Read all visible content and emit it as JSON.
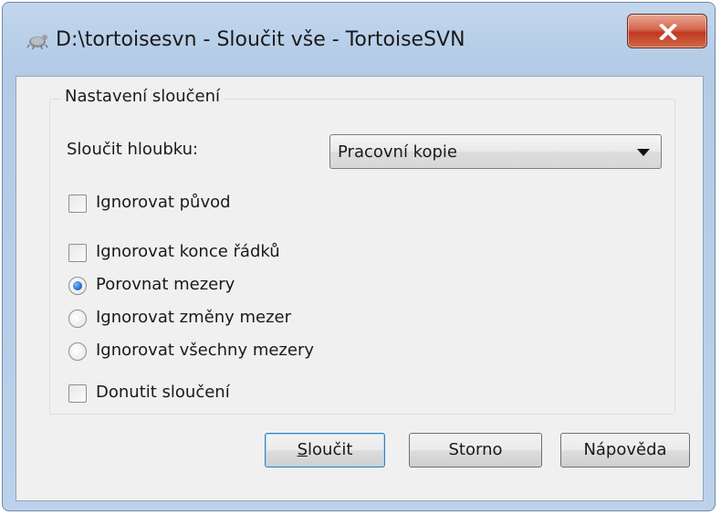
{
  "window": {
    "title": "D:\\tortoisesvn - Sloučit vše - TortoiseSVN",
    "close_glyph": "X"
  },
  "group": {
    "title": "Nastavení sloučení",
    "depth_label": "Sloučit hloubku:",
    "depth_value": "Pracovní kopie"
  },
  "options": {
    "ignore_ancestry": {
      "label": "Ignorovat původ",
      "checked": false
    },
    "ignore_eol": {
      "label": "Ignorovat konce řádků",
      "checked": false
    },
    "compare_whitespace": {
      "label": "Porovnat mezery",
      "selected": true
    },
    "ignore_whitespace_changes": {
      "label": "Ignorovat změny mezer",
      "selected": false
    },
    "ignore_all_whitespace": {
      "label": "Ignorovat všechny mezery",
      "selected": false
    },
    "force_merge": {
      "label": "Donutit sloučení",
      "checked": false
    }
  },
  "buttons": {
    "merge_mnemonic": "S",
    "merge_rest": "loučit",
    "cancel": "Storno",
    "help": "Nápověda"
  }
}
